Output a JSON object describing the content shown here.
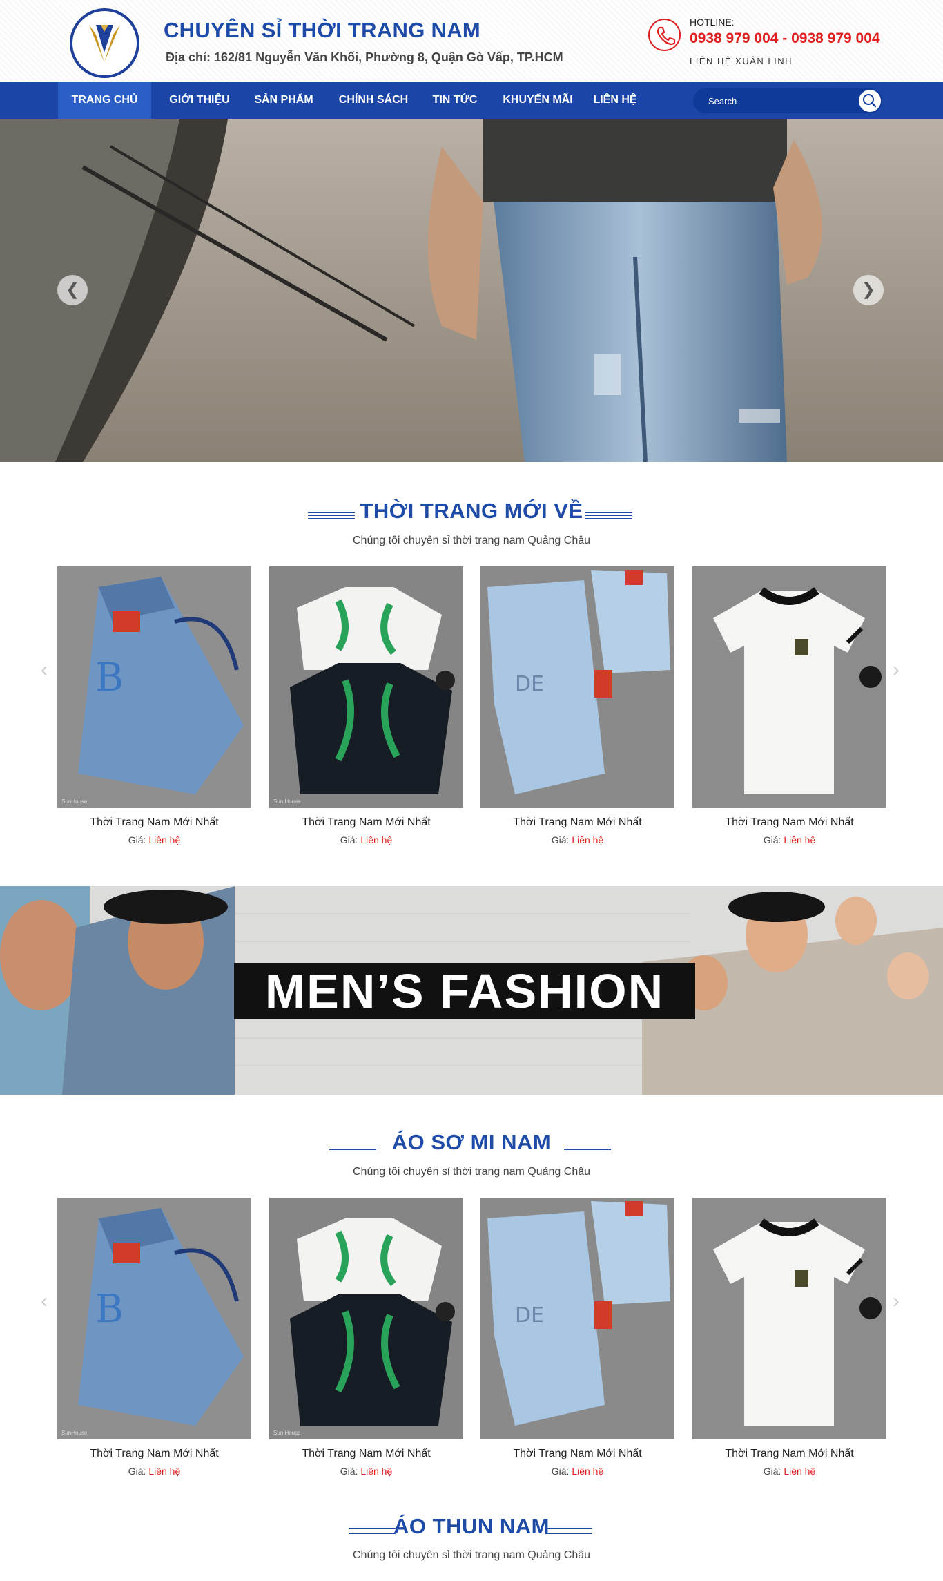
{
  "header": {
    "title": "CHUYÊN SỈ THỜI TRANG NAM",
    "address": "Địa chỉ: 162/81 Nguyễn Văn Khối, Phường 8, Quận Gò Vấp, TP.HCM",
    "hotline_label": "HOTLINE:",
    "hotline_numbers": "0938 979 004 - 0938 979 004",
    "contact_name": "LIÊN HỆ XUÂN LINH"
  },
  "nav": {
    "items": [
      "TRANG CHỦ",
      "GIỚI THIỆU",
      "SẢN PHẨM",
      "CHÍNH SÁCH",
      "TIN TỨC",
      "KHUYẾN MÃI",
      "LIÊN HỆ"
    ],
    "active": "TRANG CHỦ"
  },
  "search": {
    "placeholder": "Search"
  },
  "hero": {
    "prev": "❮",
    "next": "❯"
  },
  "sections": [
    {
      "title": "THỜI TRANG MỚI VỀ",
      "subtitle": "Chúng tôi chuyên sỉ thời trang nam Quảng Châu",
      "products": [
        {
          "name": "Thời Trang Nam Mới Nhất",
          "price_label": "Giá:",
          "price": "Liên hệ",
          "watermark": "SunHouse"
        },
        {
          "name": "Thời Trang Nam Mới Nhất",
          "price_label": "Giá:",
          "price": "Liên hệ",
          "watermark": "Sun House"
        },
        {
          "name": "Thời Trang Nam Mới Nhất",
          "price_label": "Giá:",
          "price": "Liên hệ"
        },
        {
          "name": "Thời Trang Nam Mới Nhất",
          "price_label": "Giá:",
          "price": "Liên hệ"
        }
      ]
    },
    {
      "title": "ÁO SƠ MI NAM",
      "subtitle": "Chúng tôi chuyên sỉ thời trang nam Quảng Châu",
      "products": [
        {
          "name": "Thời Trang Nam Mới Nhất",
          "price_label": "Giá:",
          "price": "Liên hệ",
          "watermark": "SunHouse"
        },
        {
          "name": "Thời Trang Nam Mới Nhất",
          "price_label": "Giá:",
          "price": "Liên hệ",
          "watermark": "Sun House"
        },
        {
          "name": "Thời Trang Nam Mới Nhất",
          "price_label": "Giá:",
          "price": "Liên hệ"
        },
        {
          "name": "Thời Trang Nam Mới Nhất",
          "price_label": "Giá:",
          "price": "Liên hệ"
        }
      ]
    },
    {
      "title": "ÁO THUN NAM",
      "subtitle": "Chúng tôi chuyên sỉ thời trang nam Quảng Châu"
    }
  ],
  "banner": {
    "text": "MEN’S FASHION"
  },
  "carousel": {
    "prev": "‹",
    "next": "›"
  },
  "colors": {
    "brand_blue": "#1c45a8",
    "accent_red": "#e02020"
  },
  "icons": [
    "logo-icon",
    "phone-icon",
    "search-icon"
  ]
}
